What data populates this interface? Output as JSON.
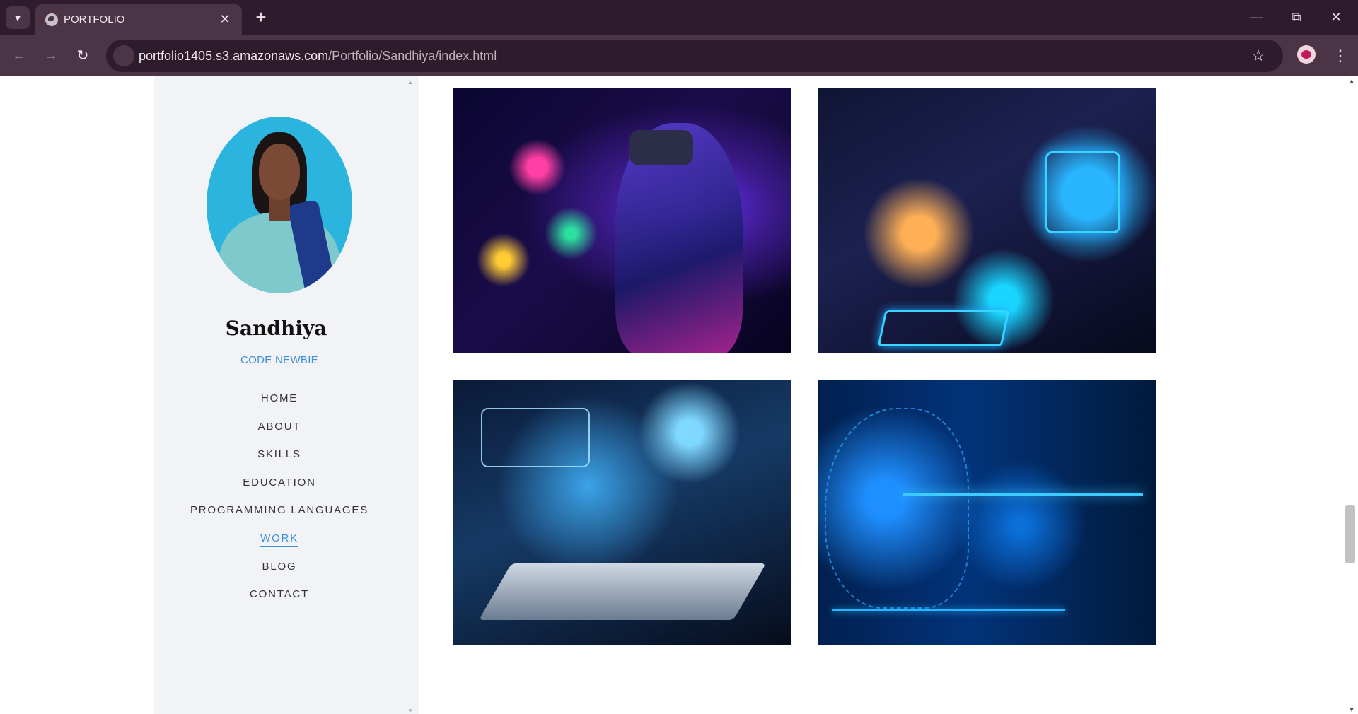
{
  "browser": {
    "tab_title": "PORTFOLIO",
    "url_host": "portfolio1405.s3.amazonaws.com",
    "url_path": "/Portfolio/Sandhiya/index.html"
  },
  "profile": {
    "name": "Sandhiya",
    "role": "CODE NEWBIE"
  },
  "nav": {
    "items": [
      {
        "label": "HOME"
      },
      {
        "label": "ABOUT"
      },
      {
        "label": "SKILLS"
      },
      {
        "label": "EDUCATION"
      },
      {
        "label": "PROGRAMMING LANGUAGES"
      },
      {
        "label": "WORK",
        "active": true
      },
      {
        "label": "BLOG"
      },
      {
        "label": "CONTACT"
      }
    ]
  },
  "colors": {
    "accent": "#3d8fd6",
    "sidebar_bg": "#f2f3f7",
    "chrome_dark": "#2e1b2b",
    "chrome_mid": "#4a3446"
  }
}
